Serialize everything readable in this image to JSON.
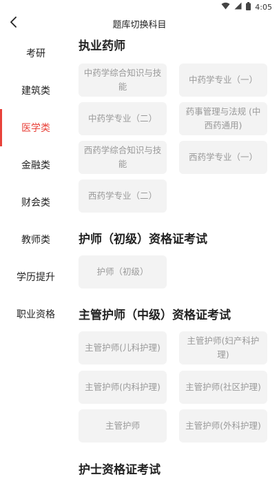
{
  "status_bar": {
    "time": "4:05"
  },
  "header": {
    "title": "题库切换科目"
  },
  "sidebar": {
    "items": [
      {
        "label": "考研"
      },
      {
        "label": "建筑类"
      },
      {
        "label": "医学类"
      },
      {
        "label": "金融类"
      },
      {
        "label": "财会类"
      },
      {
        "label": "教师类"
      },
      {
        "label": "学历提升"
      },
      {
        "label": "职业资格"
      }
    ]
  },
  "main": {
    "sections": [
      {
        "title": "执业药师",
        "items": [
          "中药学综合知识与技能",
          "中药学专业（一）",
          "中药学专业（二）",
          "药事管理与法规 (中西药通用)",
          "西药学综合知识与技能",
          "西药学专业（一）",
          "西药学专业（二）"
        ]
      },
      {
        "title": "护师（初级）资格证考试",
        "items": [
          "护师（初级）"
        ]
      },
      {
        "title": "主管护师（中级）资格证考试",
        "items": [
          "主管护师(儿科护理)",
          "主管护师(妇产科护理)",
          "主管护师(内科护理)",
          "主管护师(社区护理)",
          "主管护师",
          "主管护师(外科护理)"
        ]
      },
      {
        "title": "护士资格证考试",
        "items": []
      }
    ]
  }
}
